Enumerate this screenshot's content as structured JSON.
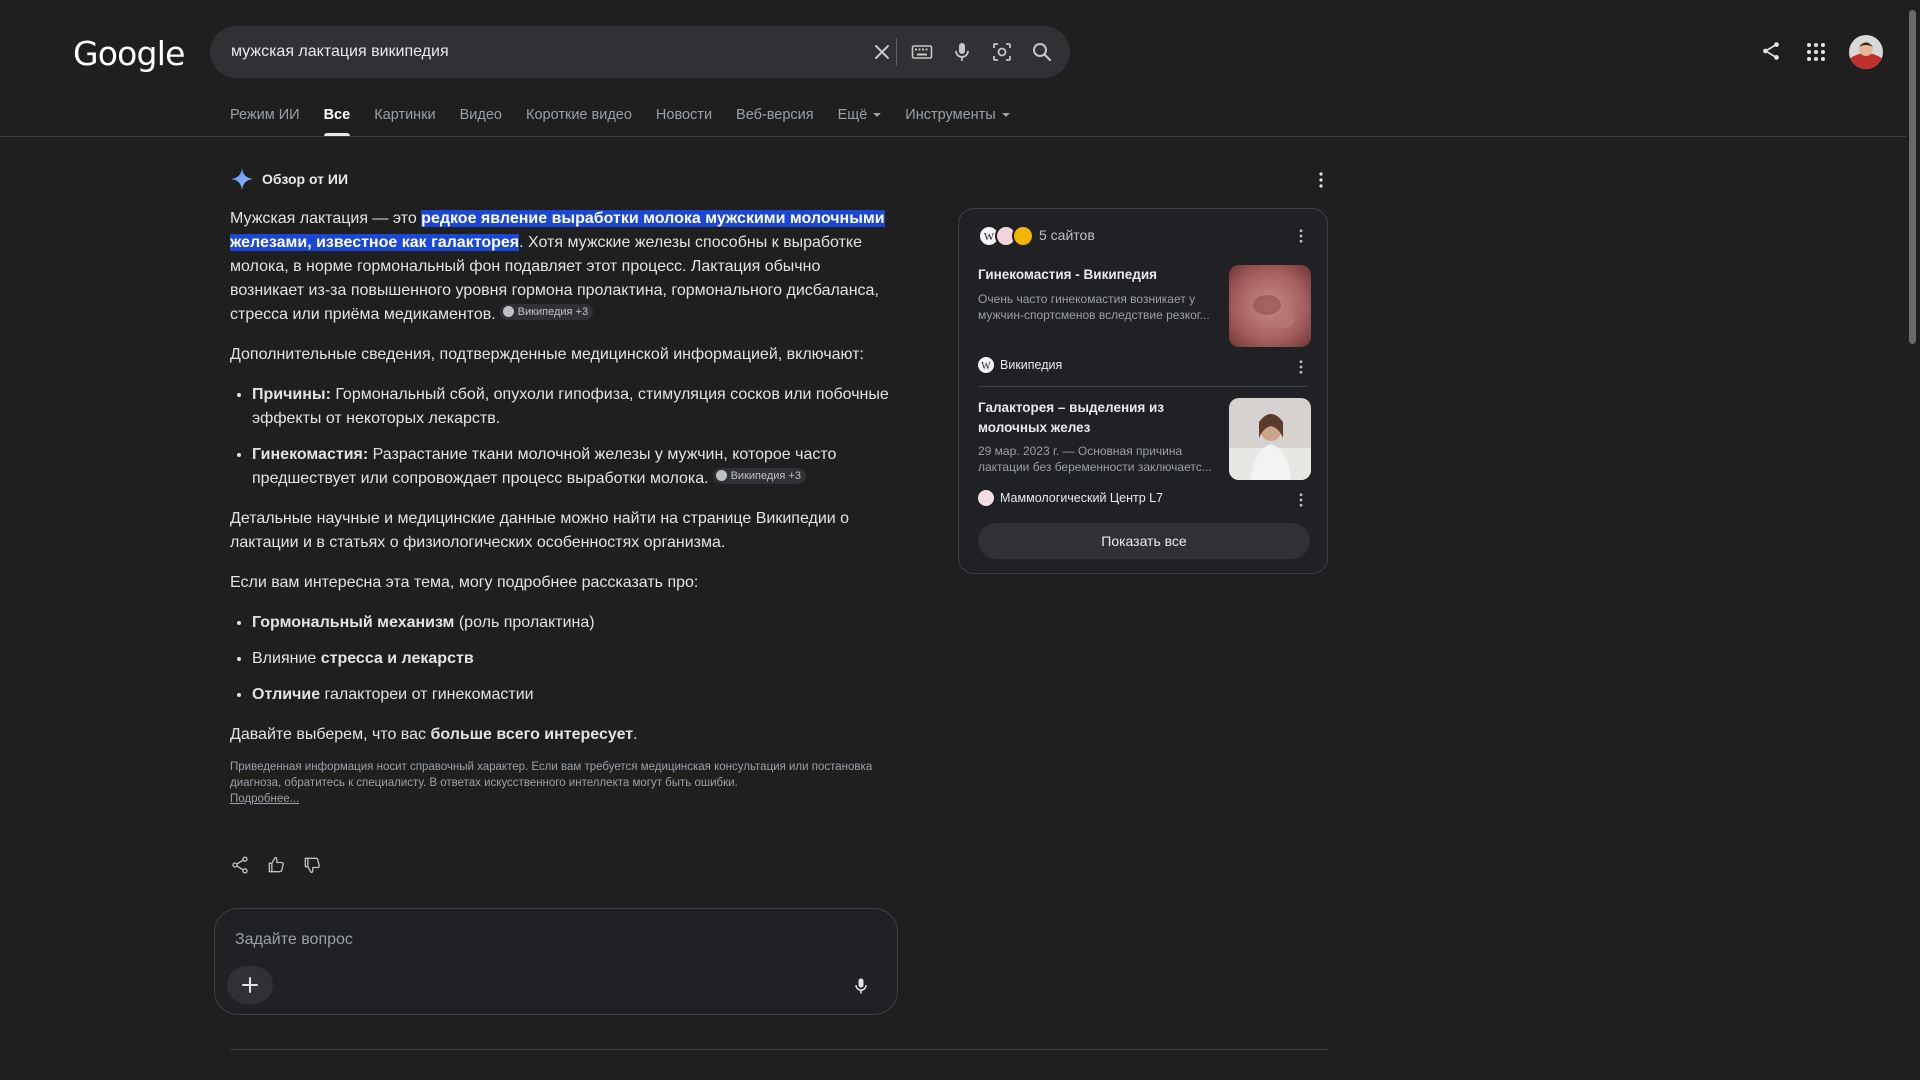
{
  "header": {
    "logo": "Google",
    "search_query": "мужская лактация википедия"
  },
  "tabs": [
    {
      "label": "Режим ИИ"
    },
    {
      "label": "Все",
      "active": true
    },
    {
      "label": "Картинки"
    },
    {
      "label": "Видео"
    },
    {
      "label": "Короткие видео"
    },
    {
      "label": "Новости"
    },
    {
      "label": "Веб-версия"
    },
    {
      "label": "Ещё",
      "dropdown": true
    },
    {
      "label": "Инструменты",
      "dropdown": true
    }
  ],
  "ai_overview": {
    "title": "Обзор от ИИ",
    "p1_start": "Мужская лактация — это ",
    "p1_highlight": "редкое явление выработки молока мужскими молочными железами, известное как галакторея",
    "p1_rest": ". Хотя мужские железы способны к выработке молока, в норме гормональный фон подавляет этот процесс. Лактация обычно возникает из-за повышенного уровня гормона пролактина, гормонального дисбаланса, стресса или приёма медикаментов.",
    "citation": "Википедия +3",
    "p2": "Дополнительные сведения, подтвержденные медицинской информацией, включают:",
    "bullets": [
      {
        "term": "Причины:",
        "text": " Гормональный сбой, опухоли гипофиза, стимуляция сосков или побочные эффекты от некоторых лекарств."
      },
      {
        "term": "Гинекомастия:",
        "text": " Разрастание ткани молочной железы у мужчин, которое часто предшествует или сопровождает процесс выработки молока."
      }
    ],
    "p3": "Детальные научные и медицинские данные можно найти на странице Википедии о лактации и в статьях о физиологических особенностях организма.",
    "p4": "Если вам интересна эта тема, могу подробнее рассказать про:",
    "topics": [
      {
        "bold": "Гормональный механизм",
        "rest": " (роль пролактина)"
      },
      {
        "pre": "Влияние ",
        "bold": "стресса и лекарств"
      },
      {
        "bold": "Отличие",
        "rest": " галактореи от гинекомастии"
      }
    ],
    "p5_start": "Давайте выберем, что вас ",
    "p5_bold": "больше всего интересует",
    "p5_end": ".",
    "disclaimer": "Приведенная информация носит справочный характер. Если вам требуется медицинская консультация или постановка диагноза, обратитесь к специалисту. В ответах искусственного интеллекта могут быть ошибки.",
    "more_link": "Подробнее..."
  },
  "sources": {
    "count_label": "5 сайтов",
    "items": [
      {
        "title": "Гинекомастия - Википедия",
        "desc": "Очень часто гинекомастия возникает у мужчин-спортсменов вследствие резког...",
        "site": "Википедия"
      },
      {
        "title": "Галакторея – выделения из молочных желез",
        "desc": "29 мар. 2023 г. — Основная причина лактации без беременности заключаетс...",
        "site": "Маммологический Центр L7"
      }
    ],
    "show_all": "Показать все"
  },
  "ask": {
    "placeholder": "Задайте вопрос"
  }
}
